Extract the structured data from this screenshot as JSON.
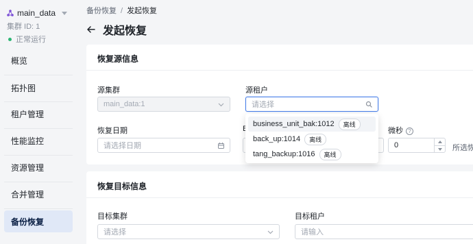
{
  "sidebar": {
    "cluster_name": "main_data",
    "cluster_id": "集群 ID: 1",
    "cluster_status": "正常运行",
    "items": [
      {
        "label": "概览"
      },
      {
        "label": "拓扑图"
      },
      {
        "label": "租户管理"
      },
      {
        "label": "性能监控"
      },
      {
        "label": "资源管理"
      },
      {
        "label": "合并管理"
      },
      {
        "label": "备份恢复"
      }
    ]
  },
  "breadcrumb": {
    "parent": "备份恢复",
    "separator": "/",
    "current": "发起恢复"
  },
  "page_title": "发起恢复",
  "source_section": {
    "title": "恢复源信息",
    "source_cluster_label": "源集群",
    "source_cluster_value": "main_data:1",
    "source_tenant_label": "源租户",
    "source_tenant_placeholder": "请选择",
    "restore_date_label": "恢复日期",
    "restore_date_placeholder": "请选择日期",
    "time_label_fragment": "B",
    "microsecond_label": "微秒",
    "microsecond_value": "0",
    "selected_hint": "所选恢"
  },
  "tenant_dropdown": [
    {
      "name": "business_unit_bak:1012",
      "tag": "离线"
    },
    {
      "name": "back_up:1014",
      "tag": "离线"
    },
    {
      "name": "tang_backup:1016",
      "tag": "离线"
    }
  ],
  "target_section": {
    "title": "恢复目标信息",
    "target_cluster_label": "目标集群",
    "target_cluster_placeholder": "请选择",
    "target_tenant_label": "目标租户",
    "target_tenant_placeholder": "请输入"
  },
  "colors": {
    "accent": "#4a80e8",
    "status_ok": "#2bb673",
    "active_nav_bg": "#e0e8f7"
  },
  "icons": [
    "cluster-logo-icon",
    "chevron-down-icon",
    "back-arrow-icon",
    "search-icon",
    "calendar-icon",
    "help-icon"
  ]
}
